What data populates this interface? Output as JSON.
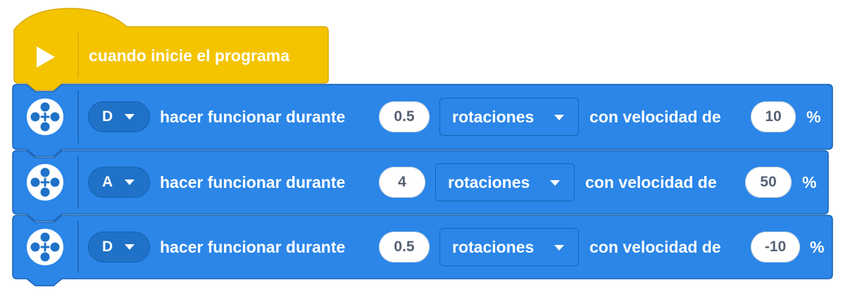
{
  "hat_block": {
    "label": "cuando inicie el programa",
    "color": "#F4C400",
    "icon": "play-icon"
  },
  "motor_blocks": [
    {
      "port": "D",
      "action_label": "hacer funcionar durante",
      "amount": "0.5",
      "unit": "rotaciones",
      "speed_label": "con velocidad de",
      "speed": "10",
      "percent": "%"
    },
    {
      "port": "A",
      "action_label": "hacer funcionar durante",
      "amount": "4",
      "unit": "rotaciones",
      "speed_label": "con velocidad de",
      "speed": "50",
      "percent": "%"
    },
    {
      "port": "D",
      "action_label": "hacer funcionar durante",
      "amount": "0.5",
      "unit": "rotaciones",
      "speed_label": "con velocidad de",
      "speed": "-10",
      "percent": "%"
    }
  ],
  "colors": {
    "motor_block": "#2B86E8",
    "motor_block_border": "#1762B3",
    "hat_block": "#F4C400",
    "hat_block_border": "#D9A800"
  },
  "icons": {
    "motor": "motor-icon",
    "dropdown": "caret-down-icon"
  }
}
